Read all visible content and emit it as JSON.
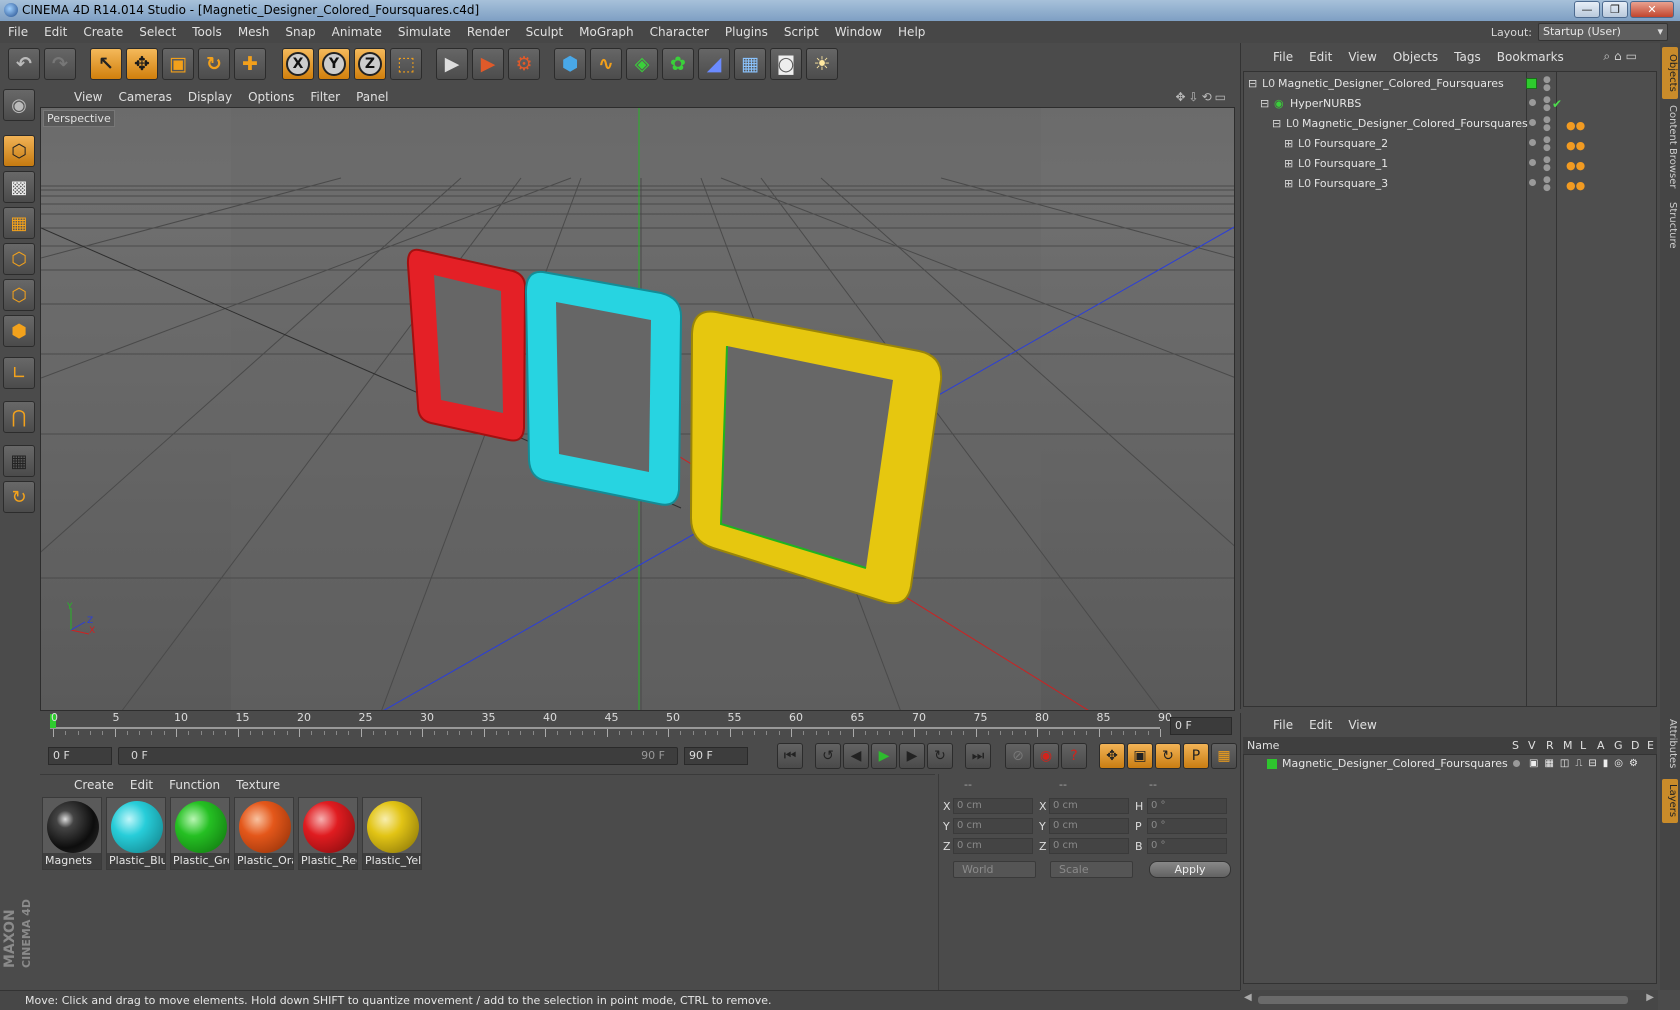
{
  "window": {
    "title": "CINEMA 4D R14.014 Studio - [Magnetic_Designer_Colored_Foursquares.c4d]",
    "minimize": "—",
    "maximize": "❐",
    "close": "✕"
  },
  "menubar": {
    "items": [
      "File",
      "Edit",
      "Create",
      "Select",
      "Tools",
      "Mesh",
      "Snap",
      "Animate",
      "Simulate",
      "Render",
      "Sculpt",
      "MoGraph",
      "Character",
      "Plugins",
      "Script",
      "Window",
      "Help"
    ],
    "layout_label": "Layout:",
    "layout_value": "Startup (User)"
  },
  "viewport": {
    "menu": [
      "View",
      "Cameras",
      "Display",
      "Options",
      "Filter",
      "Panel"
    ],
    "label": "Perspective",
    "axis_labels": {
      "y": "Y",
      "z": "Z",
      "x": "X"
    },
    "object_colors": {
      "red": "#e8262a",
      "cyan": "#29d7e4",
      "yellow": "#e5c912",
      "green": "#1fb31f"
    }
  },
  "timeline": {
    "ticks": [
      "0",
      "5",
      "10",
      "15",
      "20",
      "25",
      "30",
      "35",
      "40",
      "45",
      "50",
      "55",
      "60",
      "65",
      "70",
      "75",
      "80",
      "85",
      "90"
    ],
    "frame_field": "0 F"
  },
  "transport": {
    "start_field": "0 F",
    "range_start": "0 F",
    "range_end": "90 F",
    "end_field": "90 F"
  },
  "materials": {
    "menu": [
      "Create",
      "Edit",
      "Function",
      "Texture"
    ],
    "items": [
      {
        "name": "Magnets",
        "color": "#1a1a1a"
      },
      {
        "name": "Plastic_Blu",
        "color": "#27cdd9"
      },
      {
        "name": "Plastic_Gre",
        "color": "#25c023"
      },
      {
        "name": "Plastic_Ora",
        "color": "#e4571a"
      },
      {
        "name": "Plastic_Red",
        "color": "#e01c20"
      },
      {
        "name": "Plastic_Yell",
        "color": "#e2c415"
      }
    ]
  },
  "coords": {
    "header": [
      "--",
      "--",
      "--"
    ],
    "rows": [
      {
        "l1": "X",
        "v1": "0 cm",
        "l2": "X",
        "v2": "0 cm",
        "l3": "H",
        "v3": "0 °"
      },
      {
        "l1": "Y",
        "v1": "0 cm",
        "l2": "Y",
        "v2": "0 cm",
        "l3": "P",
        "v3": "0 °"
      },
      {
        "l1": "Z",
        "v1": "0 cm",
        "l2": "Z",
        "v2": "0 cm",
        "l3": "B",
        "v3": "0 °"
      }
    ],
    "mode": "World",
    "size_mode": "Scale",
    "apply": "Apply"
  },
  "objects": {
    "menu": [
      "File",
      "Edit",
      "View",
      "Objects",
      "Tags",
      "Bookmarks"
    ],
    "tree": [
      {
        "name": "Magnetic_Designer_Colored_Foursquares",
        "indent": 0,
        "icon": "L0"
      },
      {
        "name": "HyperNURBS",
        "indent": 1,
        "icon": "◉"
      },
      {
        "name": "Magnetic_Designer_Colored_Foursquares",
        "indent": 2,
        "icon": "L0"
      },
      {
        "name": "Foursquare_2",
        "indent": 3,
        "icon": "L0"
      },
      {
        "name": "Foursquare_1",
        "indent": 3,
        "icon": "L0"
      },
      {
        "name": "Foursquare_3",
        "indent": 3,
        "icon": "L0"
      }
    ]
  },
  "layers": {
    "menu": [
      "File",
      "Edit",
      "View"
    ],
    "columns": [
      "Name",
      "S",
      "V",
      "R",
      "M",
      "L",
      "A",
      "G",
      "D",
      "E"
    ],
    "rows": [
      {
        "name": "Magnetic_Designer_Colored_Foursquares",
        "color": "#2ec52e"
      }
    ]
  },
  "sidetabs": [
    "Objects",
    "Content Browser",
    "Structure",
    "Attributes",
    "Layers"
  ],
  "branding": {
    "maxon": "MAXON",
    "cinema": "CINEMA 4D"
  },
  "status": "Move: Click and drag to move elements. Hold down SHIFT to quantize movement / add to the selection in point mode, CTRL to remove."
}
